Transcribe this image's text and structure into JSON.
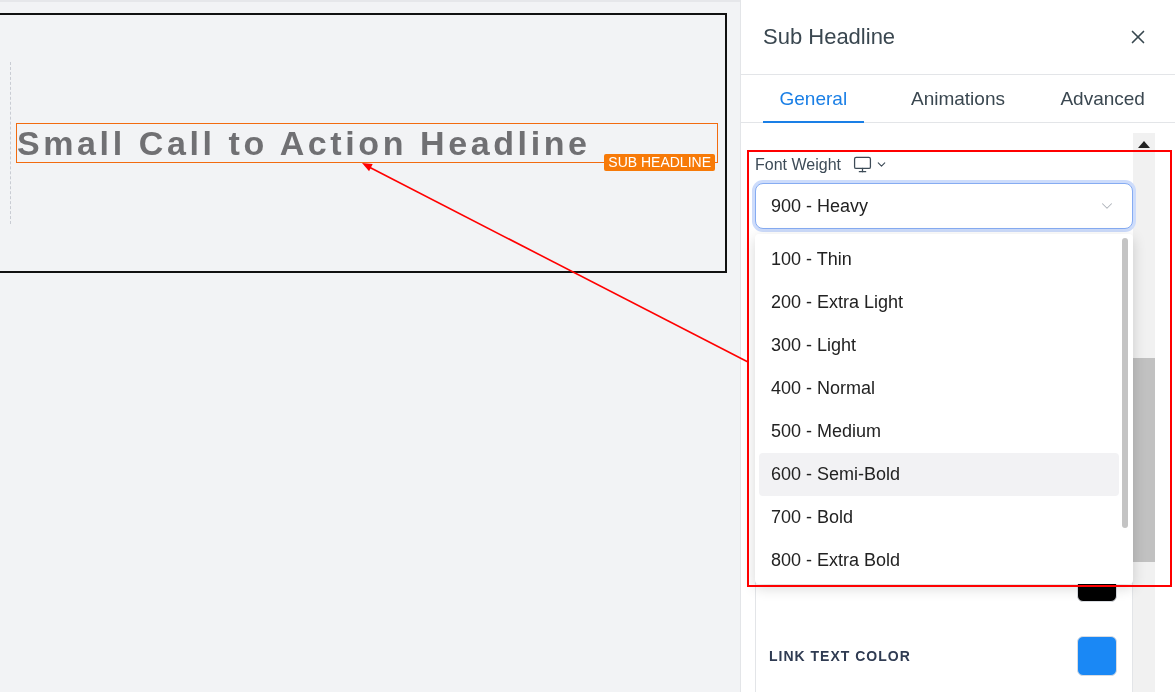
{
  "canvas": {
    "headline": "Small Call to Action Headline",
    "element_badge": "SUB HEADLINE"
  },
  "panel": {
    "title": "Sub Headline",
    "tabs": [
      {
        "label": "General",
        "selected": true
      },
      {
        "label": "Animations",
        "selected": false
      },
      {
        "label": "Advanced",
        "selected": false
      }
    ],
    "font_weight": {
      "label": "Font Weight",
      "device_picker": {
        "expanded": false
      },
      "value": "900 - Heavy",
      "expanded": true,
      "options": [
        {
          "label": "100 - Thin",
          "highlighted": false
        },
        {
          "label": "200 - Extra Light",
          "highlighted": false
        },
        {
          "label": "300 - Light",
          "highlighted": false
        },
        {
          "label": "400 - Normal",
          "highlighted": false
        },
        {
          "label": "500 - Medium",
          "highlighted": false
        },
        {
          "label": "600 - Semi-Bold",
          "highlighted": true
        },
        {
          "label": "700 - Bold",
          "highlighted": false
        },
        {
          "label": "800 - Extra Bold",
          "highlighted": false
        }
      ]
    },
    "color_settings": [
      {
        "color": "#000000"
      },
      {
        "label": "LINK TEXT COLOR",
        "color": "#1a88f5"
      }
    ]
  }
}
